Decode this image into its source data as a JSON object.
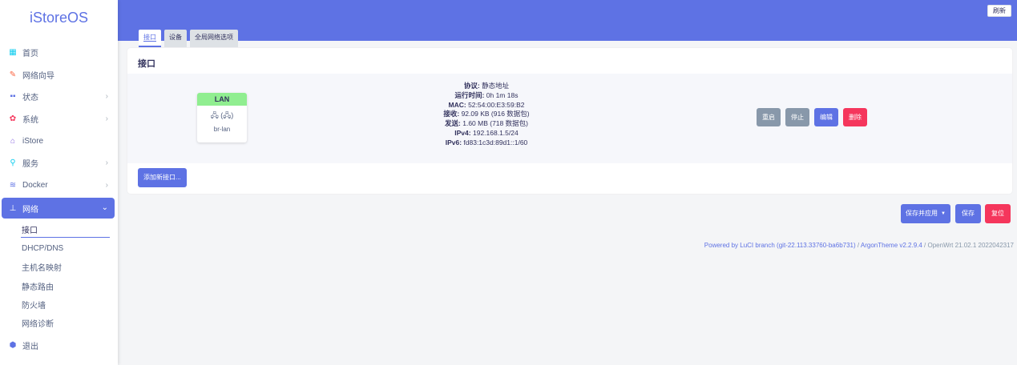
{
  "brand": "iStoreOS",
  "header": {
    "refresh_label": "刷新"
  },
  "tabs": [
    {
      "label": "接口"
    },
    {
      "label": "设备"
    },
    {
      "label": "全局网络选项"
    }
  ],
  "sidebar": {
    "items": [
      {
        "label": "首页",
        "icon": "home-icon"
      },
      {
        "label": "网络向导",
        "icon": "wizard-icon"
      },
      {
        "label": "状态",
        "icon": "status-icon"
      },
      {
        "label": "系统",
        "icon": "gear-icon"
      },
      {
        "label": "iStore",
        "icon": "store-icon"
      },
      {
        "label": "服务",
        "icon": "services-icon"
      },
      {
        "label": "Docker",
        "icon": "docker-icon"
      },
      {
        "label": "网络",
        "icon": "network-icon"
      },
      {
        "label": "退出",
        "icon": "logout-icon"
      }
    ],
    "network_sub": [
      {
        "label": "接口"
      },
      {
        "label": "DHCP/DNS"
      },
      {
        "label": "主机名映射"
      },
      {
        "label": "静态路由"
      },
      {
        "label": "防火墙"
      },
      {
        "label": "网络诊断"
      }
    ]
  },
  "card": {
    "title": "接口",
    "interface": {
      "name": "LAN",
      "device": "br-lan",
      "icons": "🖧 (🖧)",
      "protocol_label": "协议:",
      "protocol": "静态地址",
      "uptime_label": "运行时间:",
      "uptime": "0h 1m 18s",
      "mac_label": "MAC:",
      "mac": "52:54:00:E3:59:B2",
      "rx_label": "接收:",
      "rx": "92.09 KB (916 数据包)",
      "tx_label": "发送:",
      "tx": "1.60 MB (718 数据包)",
      "ipv4_label": "IPv4:",
      "ipv4": "192.168.1.5/24",
      "ipv6_label": "IPv6:",
      "ipv6": "fd83:1c3d:89d1::1/60"
    },
    "actions": {
      "restart": "重启",
      "stop": "停止",
      "edit": "编辑",
      "delete": "删除"
    },
    "add_interface": "添加新接口..."
  },
  "bottom": {
    "save_apply": "保存并应用",
    "save": "保存",
    "reset": "复位"
  },
  "footer": {
    "luci": "Powered by LuCI branch (git-22.113.33760-ba6b731)",
    "sep": " / ",
    "argon": "ArgonTheme v2.2.9.4",
    "openwrt": " / OpenWrt 21.02.1 2022042317"
  },
  "colors": {
    "accent": "#5e72e4",
    "danger": "#f5365c",
    "gray": "#8898aa",
    "lan": "#90ee90"
  }
}
